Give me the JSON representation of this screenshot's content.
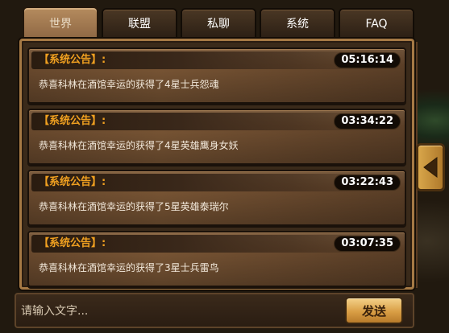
{
  "tabs": [
    {
      "label": "世界",
      "active": true
    },
    {
      "label": "联盟",
      "active": false
    },
    {
      "label": "私聊",
      "active": false
    },
    {
      "label": "系统",
      "active": false
    },
    {
      "label": "FAQ",
      "active": false
    }
  ],
  "messages": [
    {
      "label": "【系统公告】:",
      "time": "05:16:14",
      "text": "恭喜科林在酒馆幸运的获得了4星士兵怨魂"
    },
    {
      "label": "【系统公告】:",
      "time": "03:34:22",
      "text": "恭喜科林在酒馆幸运的获得了4星英雄鹰身女妖"
    },
    {
      "label": "【系统公告】:",
      "time": "03:22:43",
      "text": "恭喜科林在酒馆幸运的获得了5星英雄泰瑞尔"
    },
    {
      "label": "【系统公告】:",
      "time": "03:07:35",
      "text": "恭喜科林在酒馆幸运的获得了3星士兵雷鸟"
    }
  ],
  "input": {
    "placeholder": "请输入文字...",
    "value": ""
  },
  "send_button": {
    "label": "发送"
  },
  "side_button": {
    "icon": "arrow-left-icon"
  },
  "colors": {
    "label_orange": "#f0a020",
    "frame_gold": "#a67a45",
    "send_gold": "#d99e45"
  }
}
